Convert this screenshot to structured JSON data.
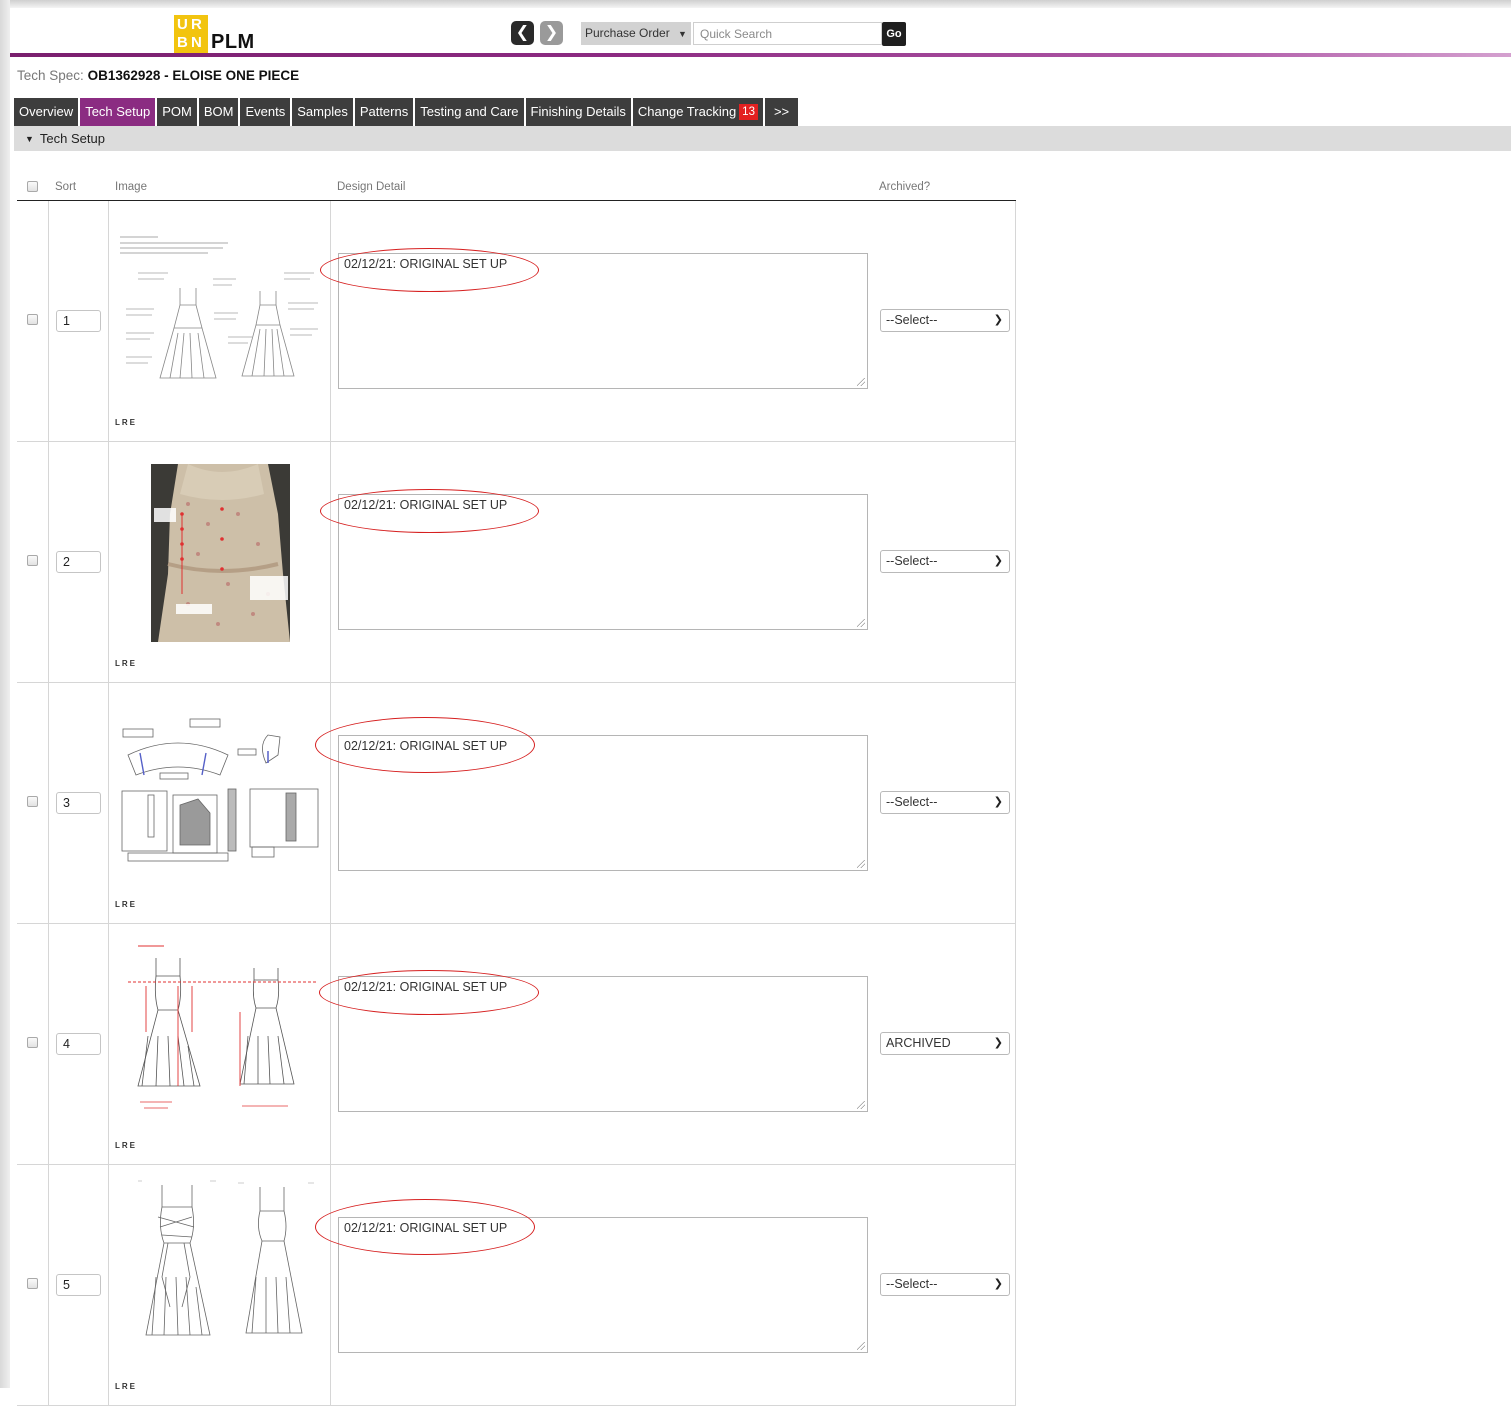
{
  "header": {
    "logo": {
      "letters": [
        "U",
        "R",
        "B",
        "N"
      ],
      "text": "PLM"
    },
    "search": {
      "type_label": "Purchase Order",
      "placeholder": "Quick Search",
      "go_label": "Go"
    }
  },
  "spec": {
    "label": "Tech Spec:",
    "value": "OB1362928 - ELOISE ONE PIECE"
  },
  "tabs": [
    {
      "label": "Overview"
    },
    {
      "label": "Tech Setup",
      "active": true
    },
    {
      "label": "POM"
    },
    {
      "label": "BOM"
    },
    {
      "label": "Events"
    },
    {
      "label": "Samples"
    },
    {
      "label": "Patterns"
    },
    {
      "label": "Testing and Care"
    },
    {
      "label": "Finishing Details"
    },
    {
      "label": "Change Tracking",
      "badge": "13"
    },
    {
      "label": ">>"
    }
  ],
  "section": {
    "title": "Tech Setup"
  },
  "table": {
    "headers": {
      "sort": "Sort",
      "image": "Image",
      "detail": "Design Detail",
      "archived": "Archived?"
    },
    "rows": [
      {
        "sort": "1",
        "image": "flat-sketch-callouts",
        "caption": "LRE",
        "detail": "02/12/21: ORIGINAL SET UP",
        "archived": "--Select--"
      },
      {
        "sort": "2",
        "image": "fit-photo",
        "caption": "LRE",
        "detail": "02/12/21: ORIGINAL SET UP",
        "archived": "--Select--"
      },
      {
        "sort": "3",
        "image": "construction-diagram",
        "caption": "LRE",
        "detail": "02/12/21: ORIGINAL SET UP",
        "archived": "--Select--"
      },
      {
        "sort": "4",
        "image": "measurement-sketch",
        "caption": "LRE",
        "detail": "02/12/21: ORIGINAL SET UP",
        "archived": "ARCHIVED"
      },
      {
        "sort": "5",
        "image": "flat-sketch",
        "caption": "LRE",
        "detail": "02/12/21: ORIGINAL SET UP",
        "archived": "--Select--"
      }
    ]
  },
  "colors": {
    "accent": "#8b2c82",
    "tab": "#3d3d3d",
    "badge": "#e32020",
    "annotation": "#d62020",
    "logo": "#f2c40f"
  }
}
